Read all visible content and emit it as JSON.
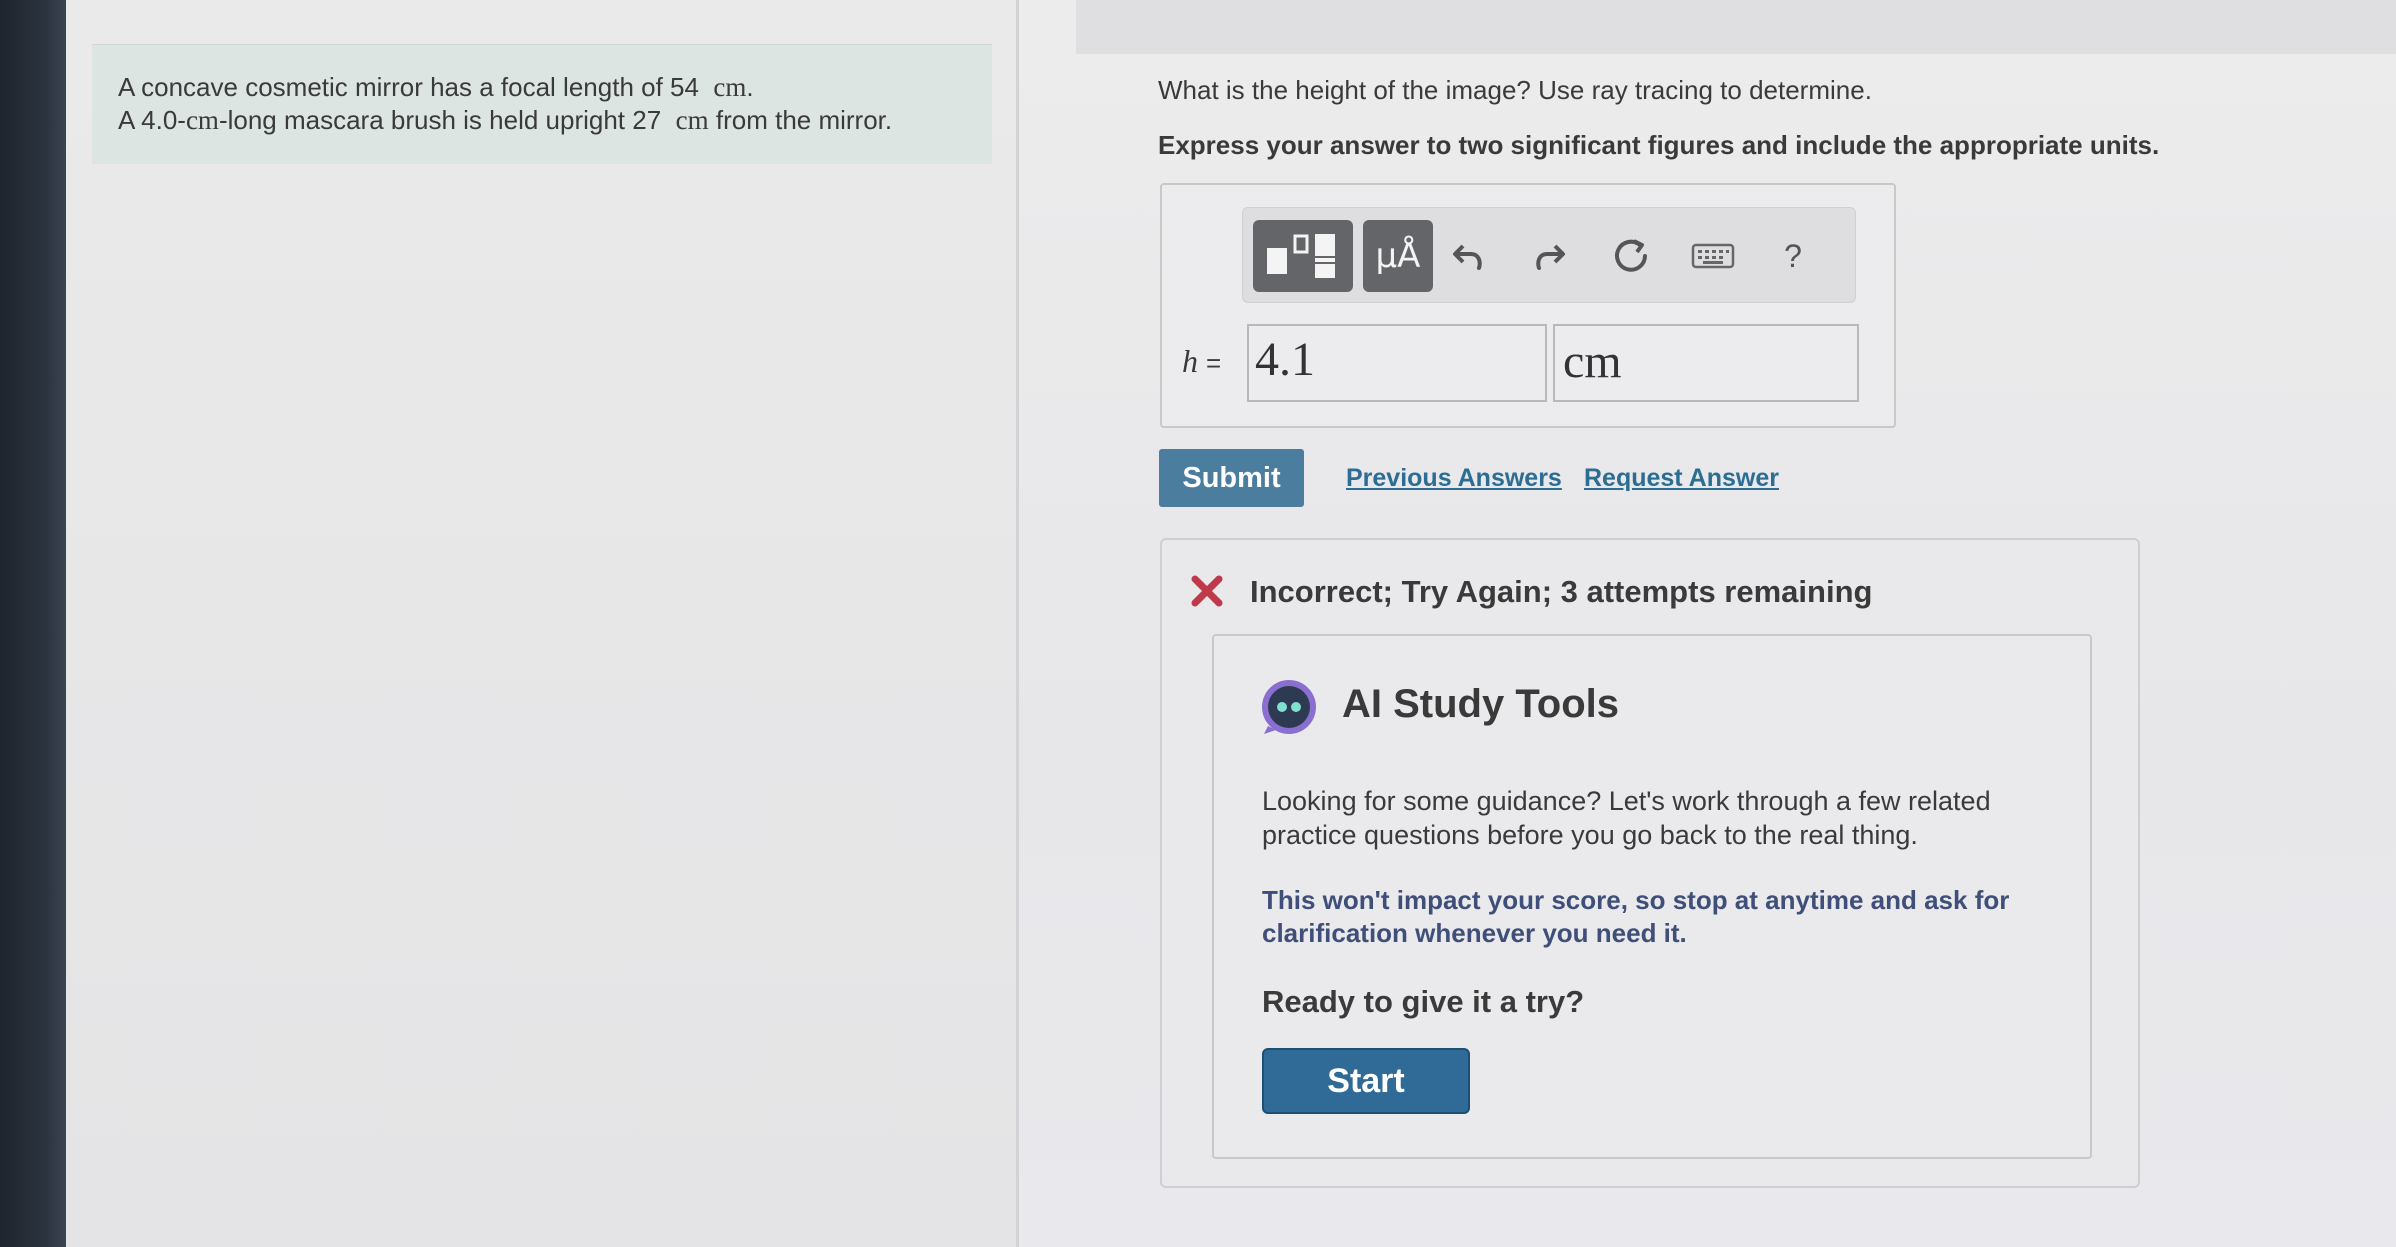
{
  "problem": {
    "line1_pre": "A concave cosmetic mirror has a focal length of 54",
    "line1_unit": "cm",
    "line1_post": ".",
    "line2_pre": "A 4.0-",
    "line2_unit": "cm",
    "line2_mid": "-long mascara brush is held upright 27",
    "line2_unit2": "cm",
    "line2_post": "from the mirror."
  },
  "question": "What is the height of the image? Use ray tracing to determine.",
  "instruction": "Express your answer to two significant figures and include the appropriate units.",
  "toolbar": {
    "templates_icon": "fraction-template-icon",
    "units_label": "μÅ",
    "undo_icon": "undo-icon",
    "redo_icon": "redo-icon",
    "reset_icon": "reset-icon",
    "keyboard_icon": "keyboard-icon",
    "help_label": "?"
  },
  "answer": {
    "variable": "h",
    "equals": "=",
    "value": "4.1",
    "unit": "cm"
  },
  "actions": {
    "submit_label": "Submit",
    "previous_answers_label": "Previous Answers",
    "request_answer_label": "Request Answer"
  },
  "feedback": {
    "status_icon": "incorrect-x-icon",
    "status_text": "Incorrect; Try Again; 3 attempts remaining",
    "status_color": "#c0394b"
  },
  "ai_tools": {
    "title": "AI Study Tools",
    "guidance": "Looking for some guidance? Let's work through a few related practice questions before you go back to the real thing.",
    "note": "This won't impact your score, so stop at anytime and ask for clarification whenever you need it.",
    "ready": "Ready to give it a try?",
    "start_label": "Start",
    "accent": "#2f6b96"
  }
}
